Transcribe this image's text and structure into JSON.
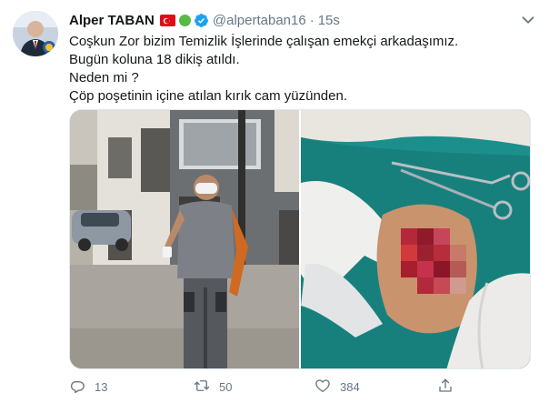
{
  "tweet": {
    "author_name": "Alper TABAN",
    "handle": "@alpertaban16",
    "separator": "·",
    "time": "15s",
    "lines": [
      "Coşkun Zor bizim Temizlik İşlerinde çalışan emekçi arkadaşımız.",
      "Bugün koluna 18 dikiş atıldı.",
      "Neden mi ?",
      "Çöp poşetinin içine atılan kırık cam yüzünden."
    ],
    "reply_count": "13",
    "retweet_count": "50",
    "like_count": "384"
  },
  "colors": {
    "text": "#14171a",
    "muted": "#657786",
    "verified": "#1da1f2",
    "flag": "#e30a17",
    "status_dot": "#58b947"
  },
  "icons": {
    "reply": "reply-icon",
    "retweet": "retweet-icon",
    "like": "heart-icon",
    "share": "share-icon",
    "more": "chevron-down-icon"
  }
}
